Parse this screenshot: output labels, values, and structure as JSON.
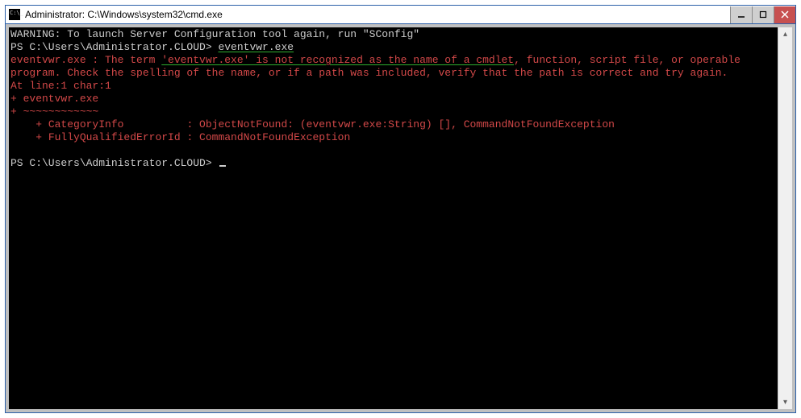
{
  "window": {
    "title": "Administrator: C:\\Windows\\system32\\cmd.exe"
  },
  "scrollbar": {
    "up_glyph": "▴",
    "down_glyph": "▾"
  },
  "terminal": {
    "banner": "WARNING: To launch Server Configuration tool again, run \"SConfig\"",
    "prompt1_prefix": "PS C:\\Users\\Administrator.CLOUD> ",
    "prompt1_cmd": "eventvwr.exe",
    "error": {
      "msg_part1": "eventvwr.exe : The term ",
      "msg_quoted": "'eventvwr.exe' is not recognized as the name of a cmdlet",
      "msg_part2": ", function, script file, or operable\nprogram. Check the spelling of the name, or if a path was included, verify that the path is correct and try again.",
      "at": "At line:1 char:1",
      "plus_cmd": "+ eventvwr.exe",
      "plus_tilde": "+ ~~~~~~~~~~~~",
      "cat": "    + CategoryInfo          : ObjectNotFound: (eventvwr.exe:String) [], CommandNotFoundException",
      "fqeid": "    + FullyQualifiedErrorId : CommandNotFoundException"
    },
    "prompt2": "PS C:\\Users\\Administrator.CLOUD> "
  }
}
